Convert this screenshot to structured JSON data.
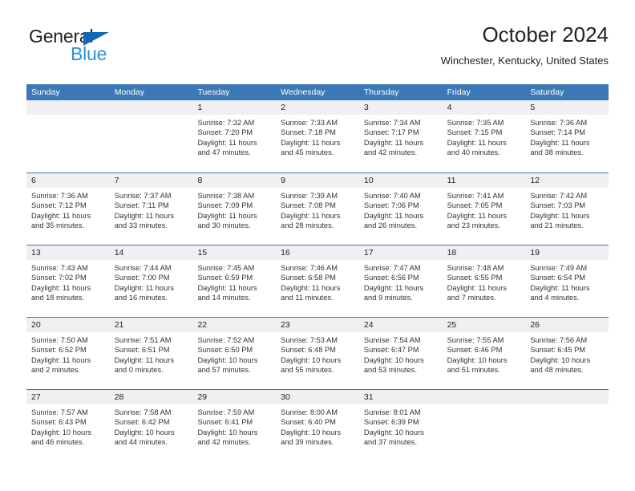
{
  "brand": {
    "name_top": "General",
    "name_bottom": "Blue",
    "color_dark": "#231f20",
    "color_blue": "#2f8fd8",
    "triangle_color": "#1168b3"
  },
  "header": {
    "title": "October 2024",
    "subtitle": "Winchester, Kentucky, United States"
  },
  "theme": {
    "header_bg": "#3c78b5",
    "header_text": "#ffffff",
    "day_number_bg": "#f0f0f0",
    "row_rule": "#3c78b5"
  },
  "weekdays": [
    "Sunday",
    "Monday",
    "Tuesday",
    "Wednesday",
    "Thursday",
    "Friday",
    "Saturday"
  ],
  "weeks": [
    [
      {
        "day": "",
        "sunrise": "",
        "sunset": "",
        "daylight": "",
        "empty": true
      },
      {
        "day": "",
        "sunrise": "",
        "sunset": "",
        "daylight": "",
        "empty": true
      },
      {
        "day": "1",
        "sunrise": "Sunrise: 7:32 AM",
        "sunset": "Sunset: 7:20 PM",
        "daylight": "Daylight: 11 hours and 47 minutes."
      },
      {
        "day": "2",
        "sunrise": "Sunrise: 7:33 AM",
        "sunset": "Sunset: 7:18 PM",
        "daylight": "Daylight: 11 hours and 45 minutes."
      },
      {
        "day": "3",
        "sunrise": "Sunrise: 7:34 AM",
        "sunset": "Sunset: 7:17 PM",
        "daylight": "Daylight: 11 hours and 42 minutes."
      },
      {
        "day": "4",
        "sunrise": "Sunrise: 7:35 AM",
        "sunset": "Sunset: 7:15 PM",
        "daylight": "Daylight: 11 hours and 40 minutes."
      },
      {
        "day": "5",
        "sunrise": "Sunrise: 7:36 AM",
        "sunset": "Sunset: 7:14 PM",
        "daylight": "Daylight: 11 hours and 38 minutes."
      }
    ],
    [
      {
        "day": "6",
        "sunrise": "Sunrise: 7:36 AM",
        "sunset": "Sunset: 7:12 PM",
        "daylight": "Daylight: 11 hours and 35 minutes."
      },
      {
        "day": "7",
        "sunrise": "Sunrise: 7:37 AM",
        "sunset": "Sunset: 7:11 PM",
        "daylight": "Daylight: 11 hours and 33 minutes."
      },
      {
        "day": "8",
        "sunrise": "Sunrise: 7:38 AM",
        "sunset": "Sunset: 7:09 PM",
        "daylight": "Daylight: 11 hours and 30 minutes."
      },
      {
        "day": "9",
        "sunrise": "Sunrise: 7:39 AM",
        "sunset": "Sunset: 7:08 PM",
        "daylight": "Daylight: 11 hours and 28 minutes."
      },
      {
        "day": "10",
        "sunrise": "Sunrise: 7:40 AM",
        "sunset": "Sunset: 7:06 PM",
        "daylight": "Daylight: 11 hours and 26 minutes."
      },
      {
        "day": "11",
        "sunrise": "Sunrise: 7:41 AM",
        "sunset": "Sunset: 7:05 PM",
        "daylight": "Daylight: 11 hours and 23 minutes."
      },
      {
        "day": "12",
        "sunrise": "Sunrise: 7:42 AM",
        "sunset": "Sunset: 7:03 PM",
        "daylight": "Daylight: 11 hours and 21 minutes."
      }
    ],
    [
      {
        "day": "13",
        "sunrise": "Sunrise: 7:43 AM",
        "sunset": "Sunset: 7:02 PM",
        "daylight": "Daylight: 11 hours and 18 minutes."
      },
      {
        "day": "14",
        "sunrise": "Sunrise: 7:44 AM",
        "sunset": "Sunset: 7:00 PM",
        "daylight": "Daylight: 11 hours and 16 minutes."
      },
      {
        "day": "15",
        "sunrise": "Sunrise: 7:45 AM",
        "sunset": "Sunset: 6:59 PM",
        "daylight": "Daylight: 11 hours and 14 minutes."
      },
      {
        "day": "16",
        "sunrise": "Sunrise: 7:46 AM",
        "sunset": "Sunset: 6:58 PM",
        "daylight": "Daylight: 11 hours and 11 minutes."
      },
      {
        "day": "17",
        "sunrise": "Sunrise: 7:47 AM",
        "sunset": "Sunset: 6:56 PM",
        "daylight": "Daylight: 11 hours and 9 minutes."
      },
      {
        "day": "18",
        "sunrise": "Sunrise: 7:48 AM",
        "sunset": "Sunset: 6:55 PM",
        "daylight": "Daylight: 11 hours and 7 minutes."
      },
      {
        "day": "19",
        "sunrise": "Sunrise: 7:49 AM",
        "sunset": "Sunset: 6:54 PM",
        "daylight": "Daylight: 11 hours and 4 minutes."
      }
    ],
    [
      {
        "day": "20",
        "sunrise": "Sunrise: 7:50 AM",
        "sunset": "Sunset: 6:52 PM",
        "daylight": "Daylight: 11 hours and 2 minutes."
      },
      {
        "day": "21",
        "sunrise": "Sunrise: 7:51 AM",
        "sunset": "Sunset: 6:51 PM",
        "daylight": "Daylight: 11 hours and 0 minutes."
      },
      {
        "day": "22",
        "sunrise": "Sunrise: 7:52 AM",
        "sunset": "Sunset: 6:50 PM",
        "daylight": "Daylight: 10 hours and 57 minutes."
      },
      {
        "day": "23",
        "sunrise": "Sunrise: 7:53 AM",
        "sunset": "Sunset: 6:48 PM",
        "daylight": "Daylight: 10 hours and 55 minutes."
      },
      {
        "day": "24",
        "sunrise": "Sunrise: 7:54 AM",
        "sunset": "Sunset: 6:47 PM",
        "daylight": "Daylight: 10 hours and 53 minutes."
      },
      {
        "day": "25",
        "sunrise": "Sunrise: 7:55 AM",
        "sunset": "Sunset: 6:46 PM",
        "daylight": "Daylight: 10 hours and 51 minutes."
      },
      {
        "day": "26",
        "sunrise": "Sunrise: 7:56 AM",
        "sunset": "Sunset: 6:45 PM",
        "daylight": "Daylight: 10 hours and 48 minutes."
      }
    ],
    [
      {
        "day": "27",
        "sunrise": "Sunrise: 7:57 AM",
        "sunset": "Sunset: 6:43 PM",
        "daylight": "Daylight: 10 hours and 46 minutes."
      },
      {
        "day": "28",
        "sunrise": "Sunrise: 7:58 AM",
        "sunset": "Sunset: 6:42 PM",
        "daylight": "Daylight: 10 hours and 44 minutes."
      },
      {
        "day": "29",
        "sunrise": "Sunrise: 7:59 AM",
        "sunset": "Sunset: 6:41 PM",
        "daylight": "Daylight: 10 hours and 42 minutes."
      },
      {
        "day": "30",
        "sunrise": "Sunrise: 8:00 AM",
        "sunset": "Sunset: 6:40 PM",
        "daylight": "Daylight: 10 hours and 39 minutes."
      },
      {
        "day": "31",
        "sunrise": "Sunrise: 8:01 AM",
        "sunset": "Sunset: 6:39 PM",
        "daylight": "Daylight: 10 hours and 37 minutes."
      },
      {
        "day": "",
        "sunrise": "",
        "sunset": "",
        "daylight": "",
        "empty": true
      },
      {
        "day": "",
        "sunrise": "",
        "sunset": "",
        "daylight": "",
        "empty": true
      }
    ]
  ]
}
